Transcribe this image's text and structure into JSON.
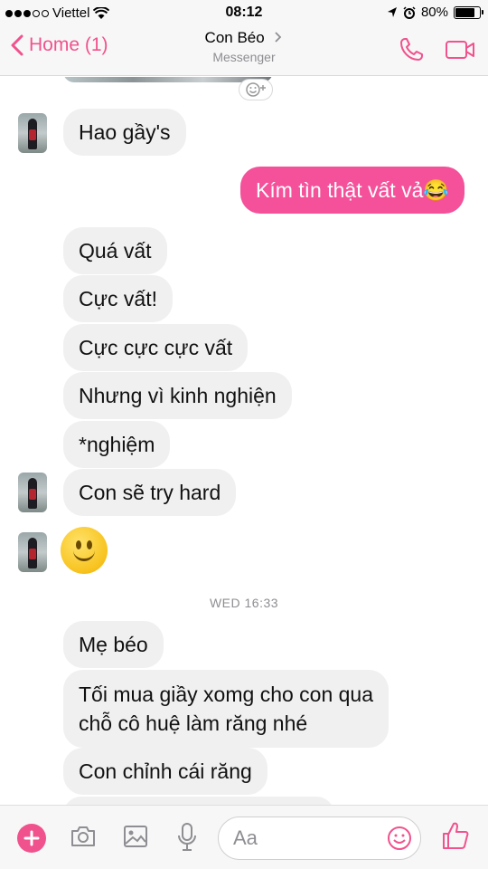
{
  "status_bar": {
    "carrier": "Viettel",
    "time": "08:12",
    "battery_text": "80%",
    "battery_level": 0.8
  },
  "nav": {
    "back_label": "Home (1)",
    "contact_name": "Con Béo",
    "subtitle": "Messenger"
  },
  "messages": [
    {
      "text": "Hao gầy's",
      "direction": "in"
    },
    {
      "text": "Kím tìn thật vất vả😂",
      "direction": "out"
    },
    {
      "text": "Quá vất",
      "direction": "in"
    },
    {
      "text": "Cực vất!",
      "direction": "in"
    },
    {
      "text": "Cực cực cực vất",
      "direction": "in"
    },
    {
      "text": "Nhưng vì kinh nghiện",
      "direction": "in"
    },
    {
      "text": "*nghiệm",
      "direction": "in"
    },
    {
      "text": "Con sẽ try hard",
      "direction": "in"
    },
    {
      "text": "Mẹ béo",
      "direction": "in"
    },
    {
      "text_line1": "Tối mua giầy xomg cho con qua",
      "text_line2": "chỗ cô huệ làm răng nhé",
      "direction": "in"
    },
    {
      "text": "Con chỉnh cái răng",
      "direction": "in"
    }
  ],
  "timestamp": "WED 16:33",
  "composer": {
    "placeholder": "Aa"
  },
  "colors": {
    "accent": "#f0528d",
    "outgoing_bubble": "#f4519a",
    "incoming_bubble": "#f0f0f0"
  },
  "icons": [
    "wifi-icon",
    "location-arrow-icon",
    "alarm-icon",
    "chevron-left-icon",
    "chevron-right-icon",
    "phone-icon",
    "video-camera-icon",
    "add-reaction-icon",
    "smiley-sticker",
    "plus-icon",
    "camera-icon",
    "image-icon",
    "microphone-icon",
    "emoji-icon",
    "thumbs-up-icon"
  ]
}
